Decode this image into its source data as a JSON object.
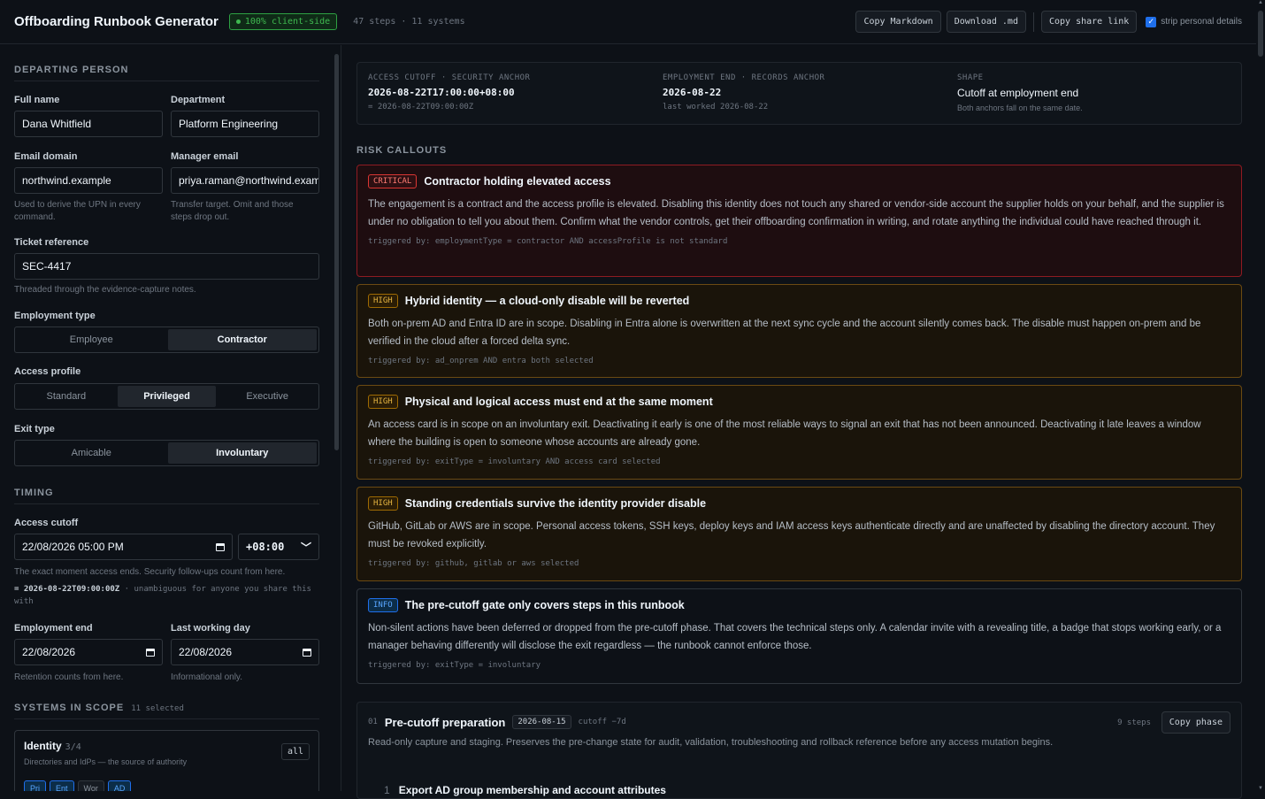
{
  "header": {
    "title": "Offboarding Runbook Generator",
    "badge": "100% client-side",
    "meta": "47 steps · 11 systems",
    "copy_markdown": "Copy Markdown",
    "download_md": "Download .md",
    "copy_share_link": "Copy share link",
    "strip_label": "strip personal details",
    "strip_checked": true
  },
  "left": {
    "departing_heading": "DEPARTING PERSON",
    "full_name_label": "Full name",
    "full_name": "Dana Whitfield",
    "department_label": "Department",
    "department": "Platform Engineering",
    "email_domain_label": "Email domain",
    "email_domain": "northwind.example",
    "email_domain_help": "Used to derive the UPN in every command.",
    "manager_email_label": "Manager email",
    "manager_email": "priya.raman@northwind.example",
    "manager_email_help": "Transfer target. Omit and those steps drop out.",
    "ticket_label": "Ticket reference",
    "ticket": "SEC-4417",
    "ticket_help": "Threaded through the evidence-capture notes.",
    "employment_type_label": "Employment type",
    "employment_type_options": [
      "Employee",
      "Contractor"
    ],
    "employment_type_selected": "Contractor",
    "access_profile_label": "Access profile",
    "access_profile_options": [
      "Standard",
      "Privileged",
      "Executive"
    ],
    "access_profile_selected": "Privileged",
    "exit_type_label": "Exit type",
    "exit_type_options": [
      "Amicable",
      "Involuntary"
    ],
    "exit_type_selected": "Involuntary",
    "timing_heading": "TIMING",
    "access_cutoff_label": "Access cutoff",
    "access_cutoff": "22/08/2026 05:00 PM",
    "tz_offset": "+08:00",
    "access_cutoff_help": "The exact moment access ends. Security follow-ups count from here.",
    "access_cutoff_utc": "= 2026-08-22T09:00:00Z",
    "access_cutoff_utc_note": "· unambiguous for anyone you share this with",
    "employment_end_label": "Employment end",
    "employment_end": "22/08/2026",
    "employment_end_help": "Retention counts from here.",
    "last_working_day_label": "Last working day",
    "last_working_day": "22/08/2026",
    "last_working_day_help": "Informational only.",
    "systems_heading": "SYSTEMS IN SCOPE",
    "systems_selected": "11 selected",
    "identity_card": {
      "title": "Identity",
      "count": "3/4",
      "desc": "Directories and IdPs — the source of authority",
      "all_button": "all",
      "chips": [
        "Pri",
        "Ent",
        "Wor",
        "AD"
      ]
    }
  },
  "anchors": {
    "cutoff_key": "ACCESS CUTOFF · SECURITY ANCHOR",
    "cutoff_value": "2026-08-22T17:00:00+08:00",
    "cutoff_sub": "= 2026-08-22T09:00:00Z",
    "end_key": "EMPLOYMENT END · RECORDS ANCHOR",
    "end_value": "2026-08-22",
    "end_sub": "last worked 2026-08-22",
    "shape_key": "SHAPE",
    "shape_value": "Cutoff at employment end",
    "shape_sub": "Both anchors fall on the same date."
  },
  "risk_heading": "RISK CALLOUTS",
  "risks": [
    {
      "level": "CRITICAL",
      "title": "Contractor holding elevated access",
      "body": "The engagement is a contract and the access profile is elevated. Disabling this identity does not touch any shared or vendor-side account the supplier holds on your behalf, and the supplier is under no obligation to tell you about them. Confirm what the vendor controls, get their offboarding confirmation in writing, and rotate anything the individual could have reached through it.",
      "trigger": "triggered by: employmentType = contractor AND accessProfile is not standard"
    },
    {
      "level": "HIGH",
      "title": "Hybrid identity — a cloud-only disable will be reverted",
      "body": "Both on-prem AD and Entra ID are in scope. Disabling in Entra alone is overwritten at the next sync cycle and the account silently comes back. The disable must happen on-prem and be verified in the cloud after a forced delta sync.",
      "trigger": "triggered by: ad_onprem AND entra both selected"
    },
    {
      "level": "HIGH",
      "title": "Physical and logical access must end at the same moment",
      "body": "An access card is in scope on an involuntary exit. Deactivating it early is one of the most reliable ways to signal an exit that has not been announced. Deactivating it late leaves a window where the building is open to someone whose accounts are already gone.",
      "trigger": "triggered by: exitType = involuntary AND access card selected"
    },
    {
      "level": "HIGH",
      "title": "Standing credentials survive the identity provider disable",
      "body": "GitHub, GitLab or AWS are in scope. Personal access tokens, SSH keys, deploy keys and IAM access keys authenticate directly and are unaffected by disabling the directory account. They must be revoked explicitly.",
      "trigger": "triggered by: github, gitlab or aws selected"
    },
    {
      "level": "INFO",
      "title": "The pre-cutoff gate only covers steps in this runbook",
      "body": "Non-silent actions have been deferred or dropped from the pre-cutoff phase. That covers the technical steps only. A calendar invite with a revealing title, a badge that stops working early, or a manager behaving differently will disclose the exit regardless — the runbook cannot enforce those.",
      "trigger": "triggered by: exitType = involuntary"
    }
  ],
  "phase": {
    "num": "01",
    "name": "Pre-cutoff preparation",
    "date": "2026-08-15",
    "rel": "cutoff −7d",
    "steps": "9 steps",
    "copy": "Copy phase",
    "desc": "Read-only capture and staging. Preserves the pre-change state for audit, validation, troubleshooting and rollback reference before any access mutation begins.",
    "first_step_num": "1",
    "first_step": "Export AD group membership and account attributes"
  },
  "colors": {
    "critical": "#da3633",
    "high": "#9e6a03",
    "info": "#1f6feb",
    "accent": "#3fb950"
  }
}
